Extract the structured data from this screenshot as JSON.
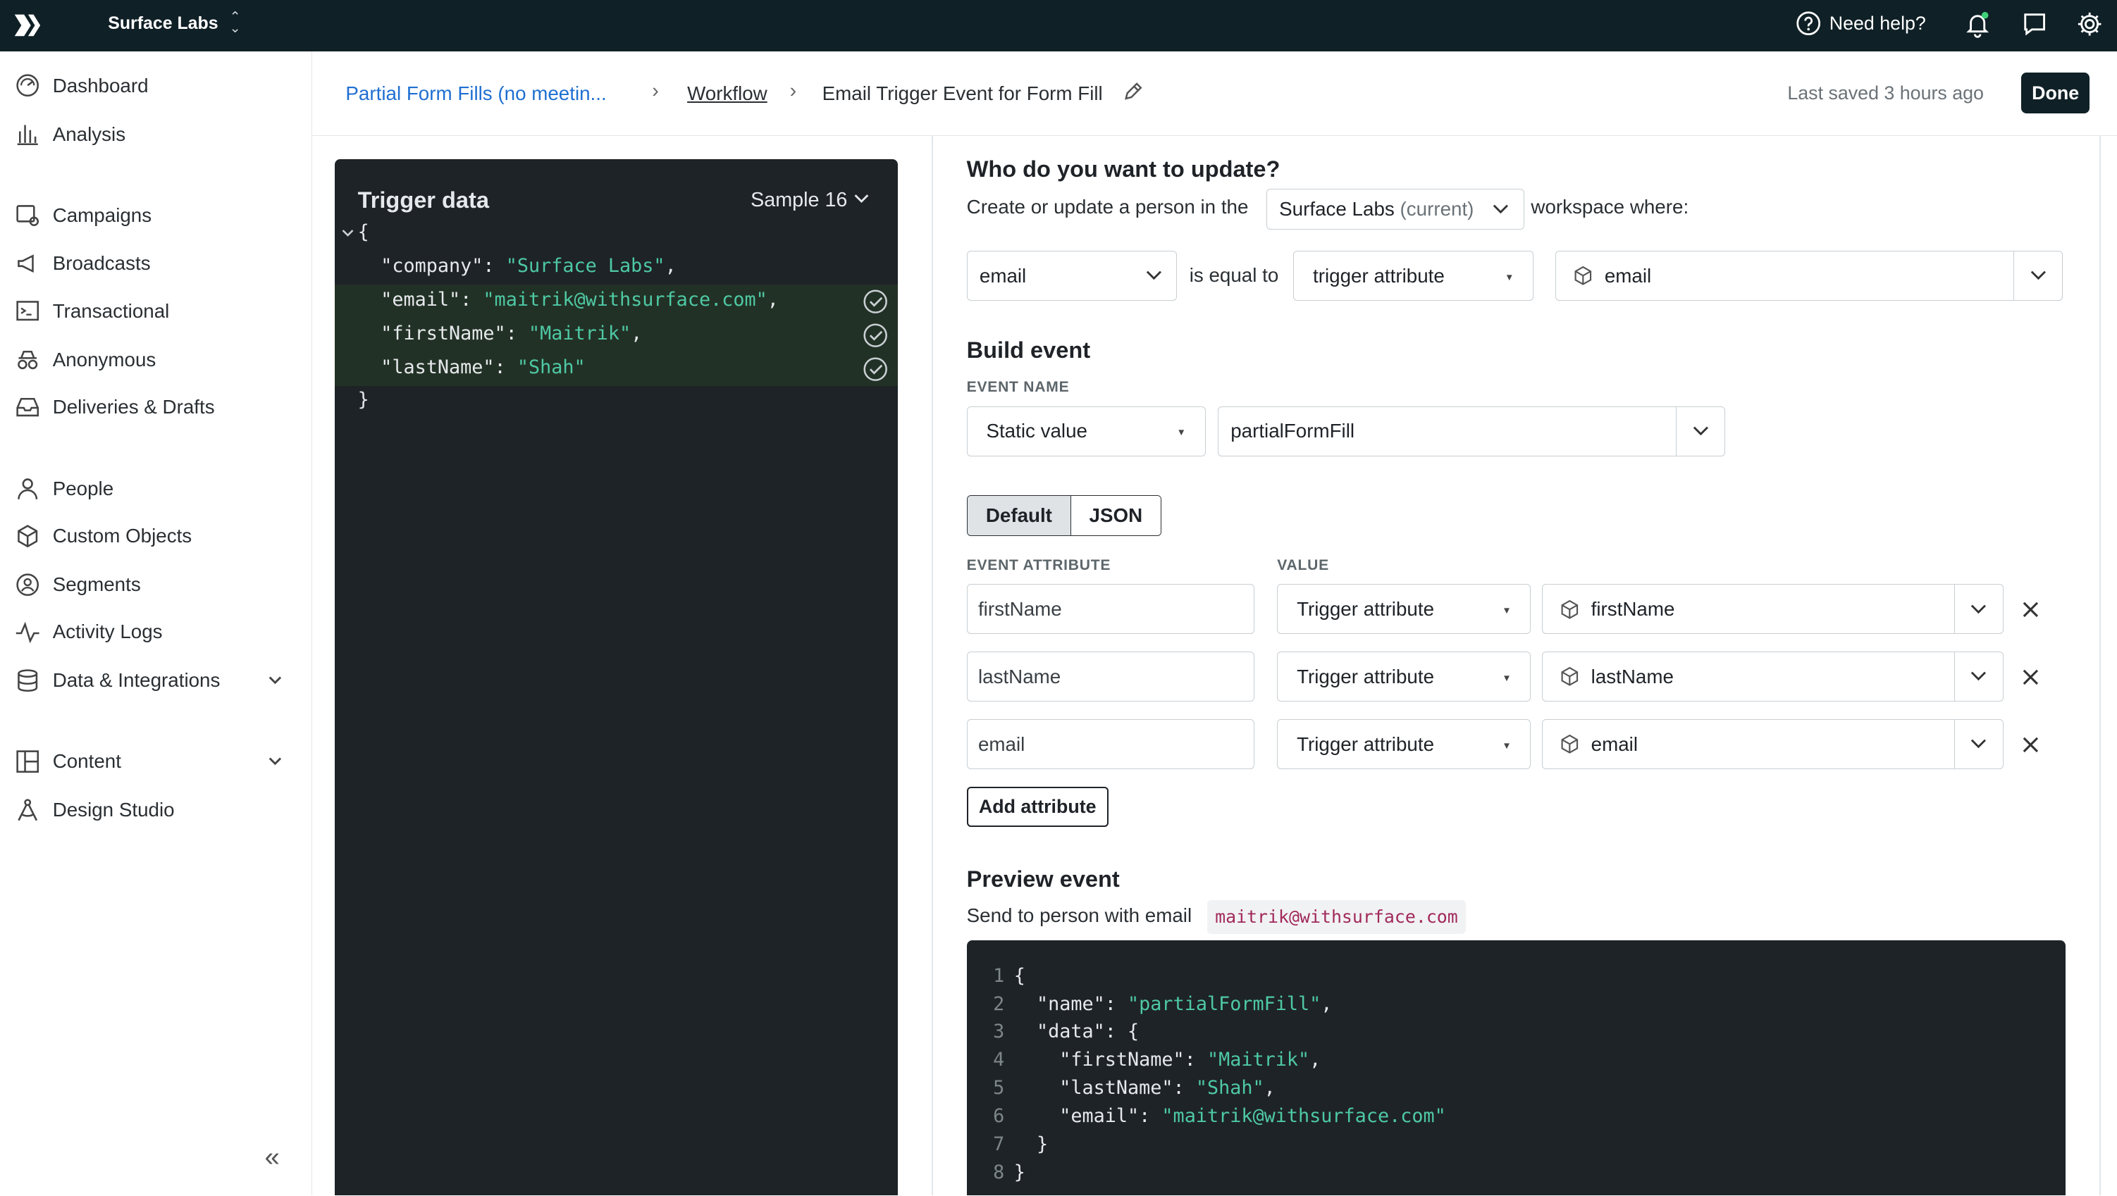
{
  "topbar": {
    "workspace": "Surface Labs",
    "help_label": "Need help?",
    "icons": [
      "logo-icon",
      "help-icon",
      "bell-icon",
      "chat-icon",
      "gear-icon"
    ]
  },
  "sidebar": {
    "items": [
      {
        "label": "Dashboard",
        "icon": "dashboard-icon"
      },
      {
        "label": "Analysis",
        "icon": "analysis-icon"
      },
      {
        "label": "Campaigns",
        "icon": "campaigns-icon"
      },
      {
        "label": "Broadcasts",
        "icon": "broadcasts-icon"
      },
      {
        "label": "Transactional",
        "icon": "transactional-icon"
      },
      {
        "label": "Anonymous",
        "icon": "anonymous-icon"
      },
      {
        "label": "Deliveries & Drafts",
        "icon": "deliveries-icon"
      },
      {
        "label": "People",
        "icon": "people-icon"
      },
      {
        "label": "Custom Objects",
        "icon": "cube-icon"
      },
      {
        "label": "Segments",
        "icon": "segments-icon"
      },
      {
        "label": "Activity Logs",
        "icon": "activity-icon"
      },
      {
        "label": "Data & Integrations",
        "icon": "database-icon"
      },
      {
        "label": "Content",
        "icon": "content-icon"
      },
      {
        "label": "Design Studio",
        "icon": "design-icon"
      }
    ],
    "collapse_glyph": "«"
  },
  "header": {
    "breadcrumb_campaign": "Partial Form Fills (no meetin...",
    "breadcrumb_workflow": "Workflow",
    "breadcrumb_current": "Email Trigger Event for Form Fill",
    "saved_text": "Last saved 3 hours ago",
    "done_label": "Done"
  },
  "trigger_panel": {
    "title": "Trigger data",
    "sample_label": "Sample 16",
    "open_brace": "{",
    "close_brace": "}",
    "rows": [
      {
        "key": "\"company\"",
        "value": "\"Surface Labs\"",
        "suffix": ",",
        "checked": false
      },
      {
        "key": "\"email\"",
        "value": "\"maitrik@withsurface.com\"",
        "suffix": ",",
        "checked": true
      },
      {
        "key": "\"firstName\"",
        "value": "\"Maitrik\"",
        "suffix": ",",
        "checked": true
      },
      {
        "key": "\"lastName\"",
        "value": "\"Shah\"",
        "suffix": "",
        "checked": true
      }
    ]
  },
  "who": {
    "title": "Who do you want to update?",
    "text_before": "Create or update a person in the",
    "workspace_name": "Surface Labs",
    "workspace_suffix": "(current)",
    "text_after": "workspace where:",
    "field": "email",
    "operator": "is equal to",
    "source": "trigger attribute",
    "attribute": "email"
  },
  "build": {
    "title": "Build event",
    "event_name_label": "EVENT NAME",
    "name_mode": "Static value",
    "event_name": "partialFormFill",
    "tabs": [
      "Default",
      "JSON"
    ],
    "active_tab": "Default",
    "col_attr": "EVENT ATTRIBUTE",
    "col_value": "VALUE",
    "attributes": [
      {
        "name": "firstName",
        "source": "Trigger attribute",
        "value": "firstName"
      },
      {
        "name": "lastName",
        "source": "Trigger attribute",
        "value": "lastName"
      },
      {
        "name": "email",
        "source": "Trigger attribute",
        "value": "email"
      }
    ],
    "add_label": "Add attribute"
  },
  "preview": {
    "title": "Preview event",
    "send_text": "Send to person with email",
    "email": "maitrik@withsurface.com",
    "lines": [
      {
        "n": "1",
        "parts": [
          [
            "p",
            "{"
          ]
        ]
      },
      {
        "n": "2",
        "parts": [
          [
            "p",
            "  \"name\": "
          ],
          [
            "s",
            "\"partialFormFill\""
          ],
          [
            "p",
            ","
          ]
        ]
      },
      {
        "n": "3",
        "parts": [
          [
            "p",
            "  \"data\": {"
          ]
        ]
      },
      {
        "n": "4",
        "parts": [
          [
            "p",
            "    \"firstName\": "
          ],
          [
            "s",
            "\"Maitrik\""
          ],
          [
            "p",
            ","
          ]
        ]
      },
      {
        "n": "5",
        "parts": [
          [
            "p",
            "    \"lastName\": "
          ],
          [
            "s",
            "\"Shah\""
          ],
          [
            "p",
            ","
          ]
        ]
      },
      {
        "n": "6",
        "parts": [
          [
            "p",
            "    \"email\": "
          ],
          [
            "s",
            "\"maitrik@withsurface.com\""
          ]
        ]
      },
      {
        "n": "7",
        "parts": [
          [
            "p",
            "  }"
          ]
        ]
      },
      {
        "n": "8",
        "parts": [
          [
            "p",
            "}"
          ]
        ]
      }
    ]
  },
  "colors": {
    "topbar": "#0f2026",
    "link": "#1f6fd1",
    "code_bg": "#1e2327",
    "code_string": "#4ec9a4"
  }
}
